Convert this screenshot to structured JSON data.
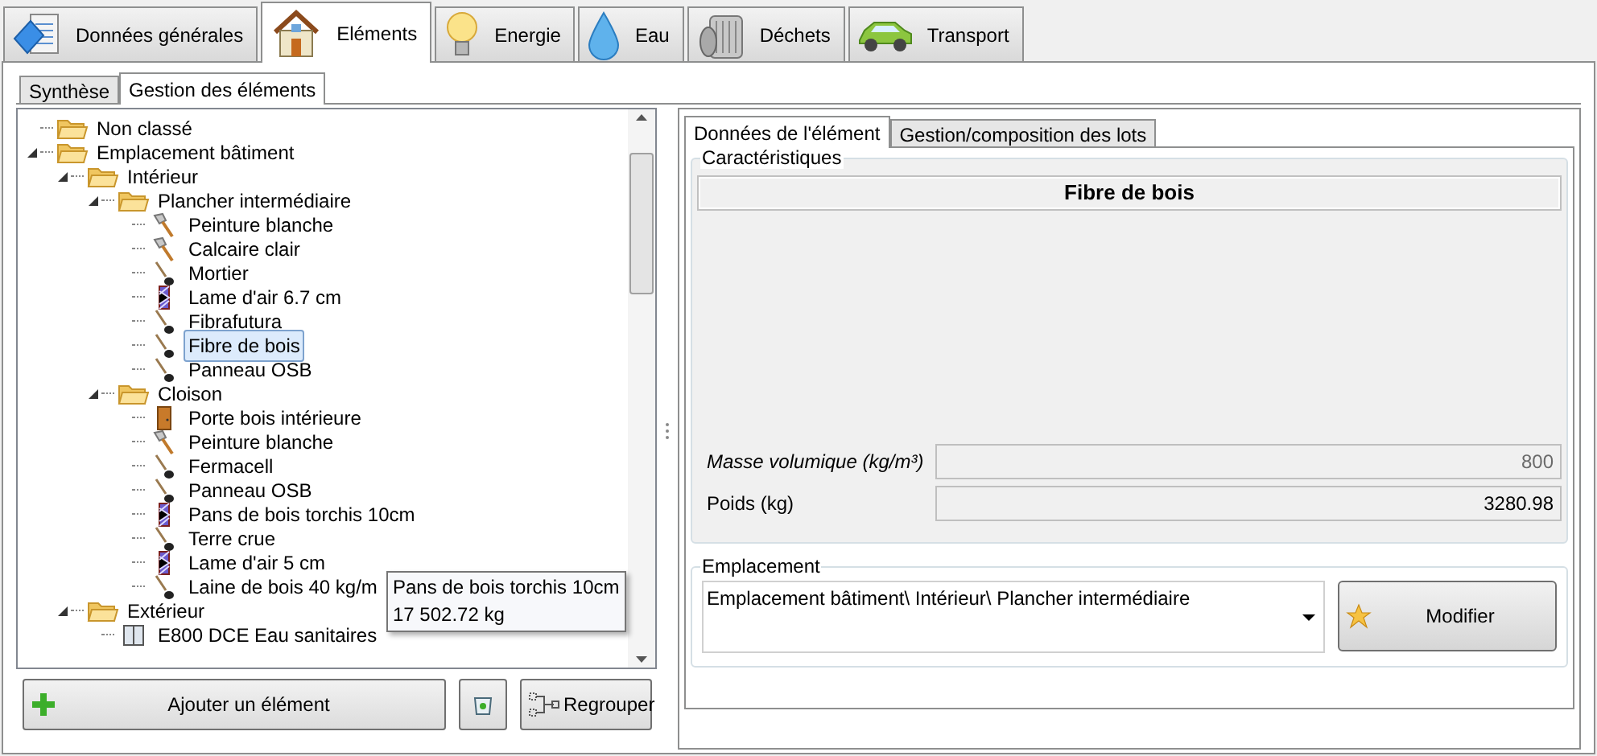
{
  "main_tabs": [
    {
      "label": "Données générales",
      "kind": "document",
      "selected": false
    },
    {
      "label": "Eléments",
      "kind": "house",
      "selected": true
    },
    {
      "label": "Energie",
      "kind": "bulb",
      "selected": false
    },
    {
      "label": "Eau",
      "kind": "drop",
      "selected": false
    },
    {
      "label": "Déchets",
      "kind": "bin",
      "selected": false
    },
    {
      "label": "Transport",
      "kind": "car",
      "selected": false
    }
  ],
  "sub_tabs": [
    {
      "label": "Synthèse",
      "selected": false
    },
    {
      "label": "Gestion des éléments",
      "selected": true
    }
  ],
  "tree": [
    {
      "label": "Non classé",
      "kind": "folder",
      "selected": false
    },
    {
      "label": "Emplacement bâtiment",
      "kind": "folder",
      "expanded": true,
      "selected": false,
      "children": [
        {
          "label": "Intérieur",
          "kind": "folder",
          "expanded": true,
          "selected": false,
          "children": [
            {
              "label": "Plancher intermédiaire",
              "kind": "folder",
              "expanded": true,
              "selected": false,
              "children": [
                {
                  "label": "Peinture blanche",
                  "kind": "brush",
                  "selected": false
                },
                {
                  "label": "Calcaire clair",
                  "kind": "brush",
                  "selected": false
                },
                {
                  "label": "Mortier",
                  "kind": "shovel",
                  "selected": false
                },
                {
                  "label": "Lame d'air 6.7 cm",
                  "kind": "layer",
                  "selected": false
                },
                {
                  "label": "Fibrafutura",
                  "kind": "shovel",
                  "selected": false
                },
                {
                  "label": "Fibre de bois",
                  "kind": "shovel",
                  "selected": true
                },
                {
                  "label": "Panneau OSB",
                  "kind": "shovel",
                  "selected": false
                }
              ]
            },
            {
              "label": "Cloison",
              "kind": "folder",
              "expanded": true,
              "selected": false,
              "children": [
                {
                  "label": "Porte bois intérieure",
                  "kind": "door",
                  "selected": false
                },
                {
                  "label": "Peinture blanche",
                  "kind": "brush",
                  "selected": false
                },
                {
                  "label": "Fermacell",
                  "kind": "shovel",
                  "selected": false
                },
                {
                  "label": "Panneau OSB",
                  "kind": "shovel",
                  "selected": false
                },
                {
                  "label": "Pans de bois torchis 10cm",
                  "kind": "layer",
                  "selected": false
                },
                {
                  "label": "Terre crue",
                  "kind": "shovel",
                  "selected": false
                },
                {
                  "label": "Lame d'air 5 cm",
                  "kind": "layer",
                  "selected": false
                },
                {
                  "label": "Laine de bois 40 kg/m",
                  "kind": "shovel",
                  "selected": false
                }
              ]
            }
          ]
        },
        {
          "label": "Extérieur",
          "kind": "folder",
          "expanded": true,
          "selected": false,
          "children": [
            {
              "label": "E800 DCE Eau sanitaires",
              "kind": "window",
              "selected": false
            }
          ]
        }
      ]
    }
  ],
  "tooltip": {
    "title": "Pans de bois torchis 10cm",
    "value": "17 502.72 kg"
  },
  "left_buttons": [
    {
      "label": "Ajouter un élément",
      "kind": "plus"
    },
    {
      "kind": "bin"
    },
    {
      "label": "Regrouper",
      "kind": "group"
    }
  ],
  "detail_tabs": [
    {
      "label": "Données de l'élément",
      "selected": true
    },
    {
      "label": "Gestion/composition des lots",
      "selected": false
    }
  ],
  "characteristics": {
    "title": "Caractéristiques",
    "heading": "Fibre de bois",
    "fields": [
      {
        "label": "Masse volumique (kg/m³)",
        "value": "800",
        "disabled": true
      },
      {
        "label": "Poids (kg)",
        "value": "3280.98",
        "disabled": false
      }
    ]
  },
  "location": {
    "title": "Emplacement",
    "value": "Emplacement bâtiment\\ Intérieur\\ Plancher intermédiaire",
    "button": "Modifier"
  }
}
